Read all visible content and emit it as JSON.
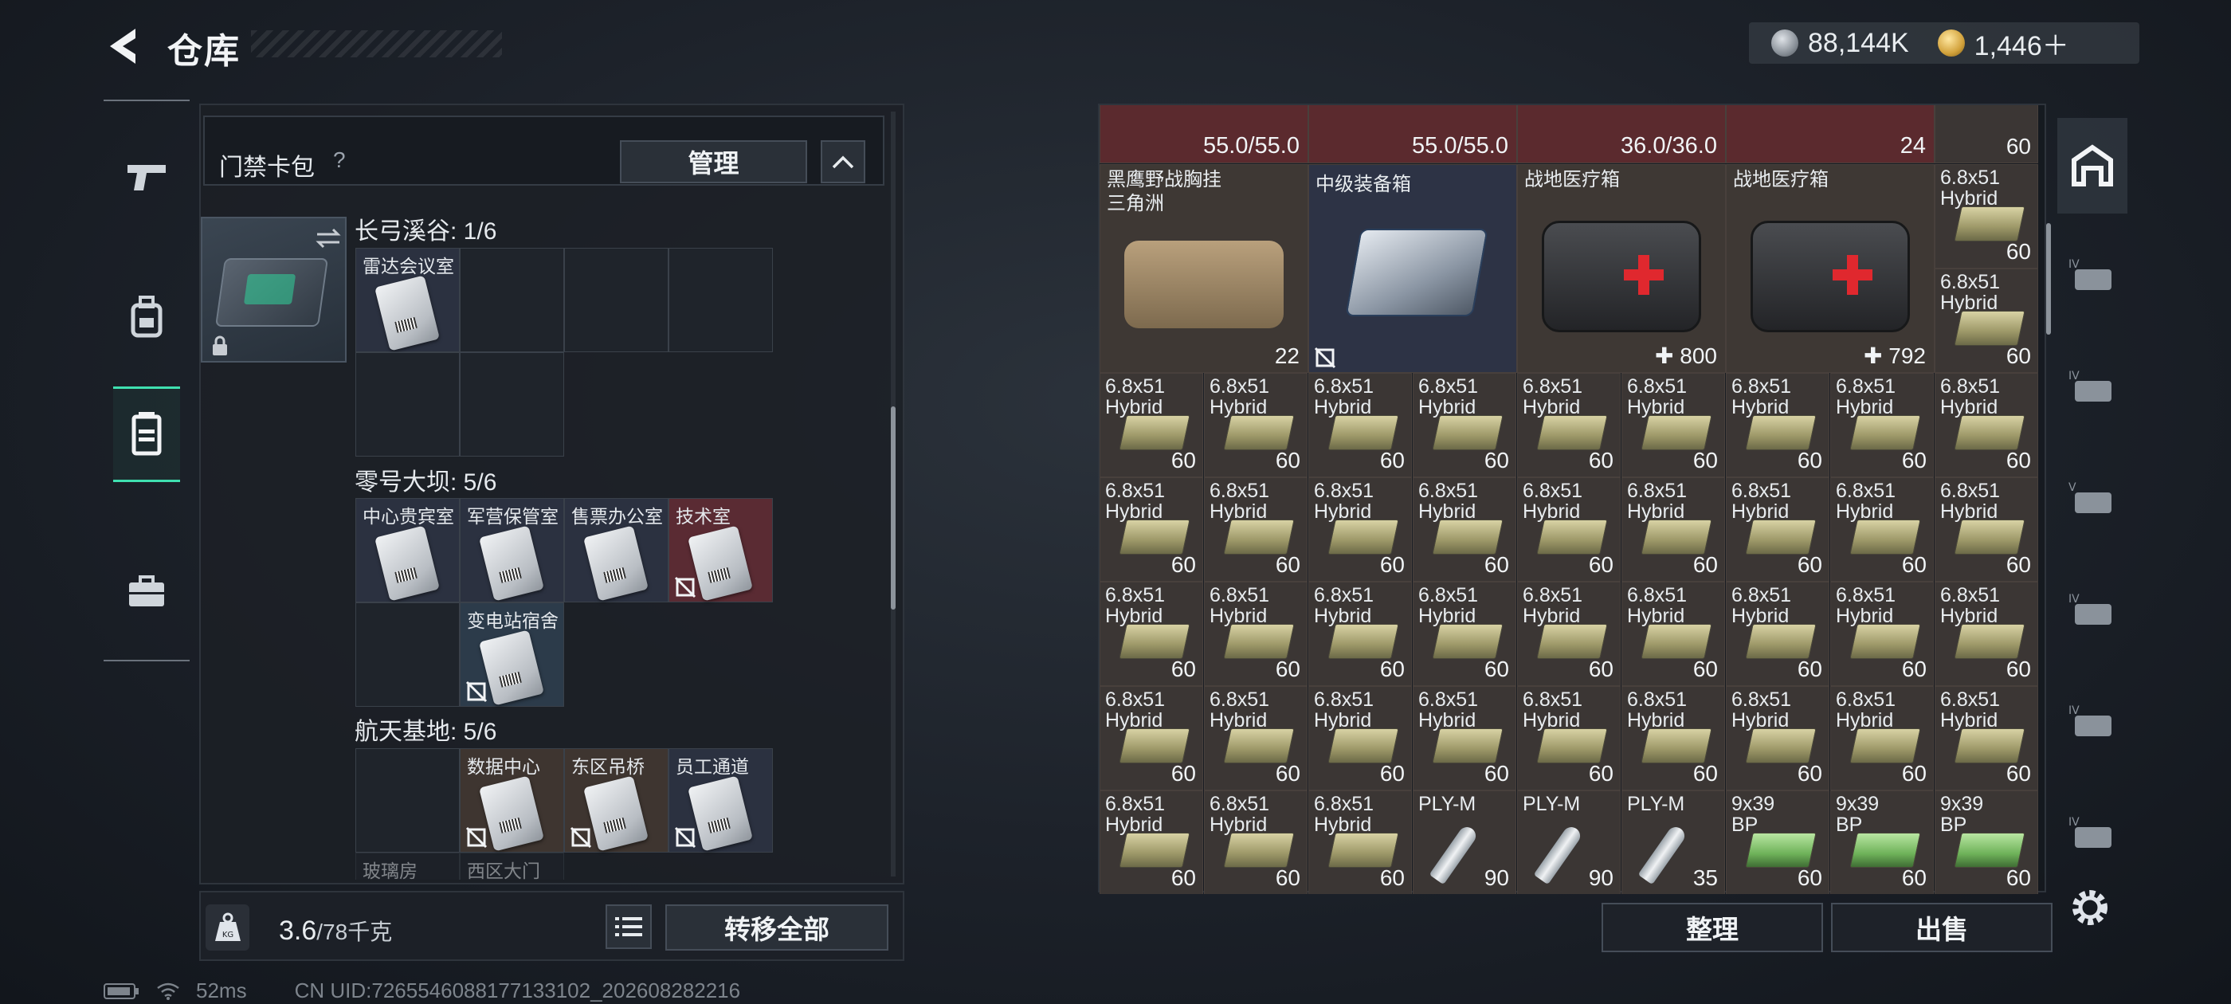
{
  "header": {
    "title": "仓库"
  },
  "currency": {
    "silver": "88,144K",
    "gold": "1,446＋"
  },
  "keybag": {
    "title": "门禁卡包",
    "help": "?",
    "manage_label": "管理",
    "sections": [
      {
        "title": "长弓溪谷: 1/6",
        "slots": [
          "雷达会议室",
          "",
          "",
          "",
          "",
          ""
        ]
      },
      {
        "title": "零号大坝: 5/6",
        "slots": [
          "中心贵宾室",
          "军营保管室",
          "售票办公室",
          "技术室",
          "",
          "变电站宿舍"
        ]
      },
      {
        "title": "航天基地: 5/6",
        "slots": [
          "",
          "数据中心",
          "东区吊桥",
          "员工通道",
          "玻璃房",
          "西区大门"
        ]
      }
    ]
  },
  "weight": {
    "current": "3.6",
    "max": "/78千克"
  },
  "buttons": {
    "transfer_all": "转移全部",
    "sort": "整理",
    "sell": "出售"
  },
  "grid": {
    "top_row": [
      "55.0/55.0",
      "55.0/55.0",
      "36.0/36.0",
      "24",
      "60"
    ],
    "large_items": [
      {
        "name": "黑鹰野战胸挂\n三角洲",
        "count": "22"
      },
      {
        "name": "中级装备箱",
        "count": ""
      },
      {
        "name": "战地医疗箱",
        "count": "800"
      },
      {
        "name": "战地医疗箱",
        "count": "792"
      }
    ],
    "ammo_name": "6.8x51\nHybrid",
    "ammo_count": "60",
    "last_row": [
      {
        "name": "6.8x51\nHybrid",
        "count": "60"
      },
      {
        "name": "6.8x51\nHybrid",
        "count": "60"
      },
      {
        "name": "6.8x51\nHybrid",
        "count": "60"
      },
      {
        "name": "PLY-M",
        "count": "90"
      },
      {
        "name": "PLY-M",
        "count": "90"
      },
      {
        "name": "PLY-M",
        "count": "35"
      },
      {
        "name": "9x39\nBP",
        "count": "60"
      },
      {
        "name": "9x39\nBP",
        "count": "60"
      },
      {
        "name": "9x39\nBP",
        "count": "60"
      }
    ]
  },
  "footer": {
    "ping": "52ms",
    "uid": "CN UID:7265546088177133102_202608282216"
  },
  "icons": [
    "back-icon",
    "pistol-icon",
    "backpack-icon",
    "vest-icon",
    "toolbox-icon",
    "help-icon",
    "chevron-up-icon",
    "swap-icon",
    "lock-icon",
    "weight-icon",
    "list-icon",
    "battery-icon",
    "wifi-icon",
    "container-icon",
    "settings-icon"
  ]
}
